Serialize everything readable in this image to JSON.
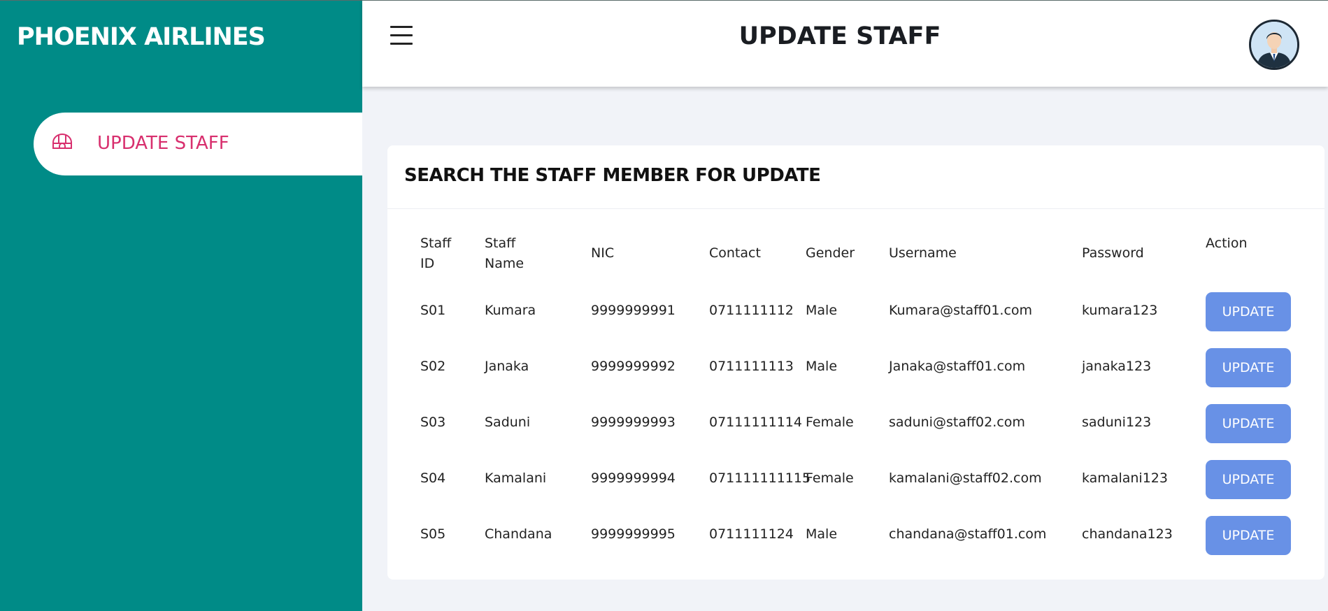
{
  "sidebar": {
    "brand": "PHOENIX AIRLINES",
    "items": [
      {
        "label": "UPDATE STAFF",
        "icon": "igloo-icon"
      }
    ]
  },
  "header": {
    "title": "UPDATE STAFF"
  },
  "card": {
    "title": "SEARCH THE STAFF MEMBER FOR UPDATE"
  },
  "table": {
    "headers": {
      "staff_id": [
        "Staff",
        "ID"
      ],
      "staff_name": [
        "Staff",
        "Name"
      ],
      "nic": "NIC",
      "contact": "Contact",
      "gender": "Gender",
      "username": "Username",
      "password": "Password",
      "action": "Action"
    },
    "rows": [
      {
        "id": "S01",
        "name": "Kumara",
        "nic": "9999999991",
        "contact": "0711111112",
        "gender": "Male",
        "username": "Kumara@staff01.com",
        "password": "kumara123",
        "action": "UPDATE"
      },
      {
        "id": "S02",
        "name": "Janaka",
        "nic": "9999999992",
        "contact": "0711111113",
        "gender": "Male",
        "username": "Janaka@staff01.com",
        "password": "janaka123",
        "action": "UPDATE"
      },
      {
        "id": "S03",
        "name": "Saduni",
        "nic": "9999999993",
        "contact": "07111111114",
        "gender": "Female",
        "username": "saduni@staff02.com",
        "password": "saduni123",
        "action": "UPDATE"
      },
      {
        "id": "S04",
        "name": "Kamalani",
        "nic": "9999999994",
        "contact": "071111111115",
        "gender": "Female",
        "username": "kamalani@staff02.com",
        "password": "kamalani123",
        "action": "UPDATE"
      },
      {
        "id": "S05",
        "name": "Chandana",
        "nic": "9999999995",
        "contact": "0711111124",
        "gender": "Male",
        "username": "chandana@staff01.com",
        "password": "chandana123",
        "action": "UPDATE"
      }
    ]
  },
  "colors": {
    "sidebar": "#008b87",
    "accent": "#d82f6e",
    "button": "#6891e6",
    "background": "#f1f3f8"
  }
}
